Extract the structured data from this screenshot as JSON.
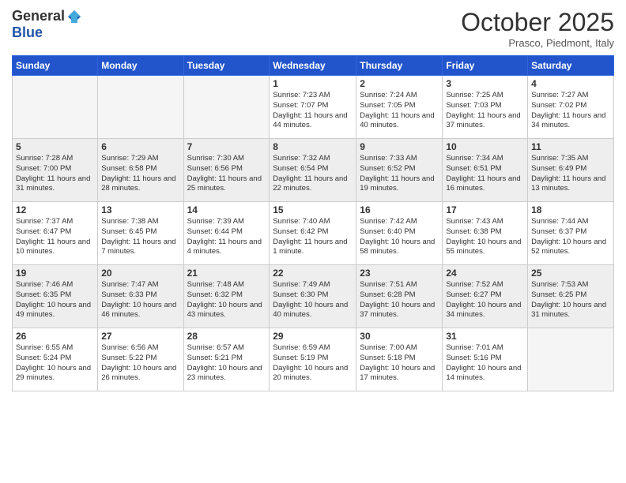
{
  "logo": {
    "general": "General",
    "blue": "Blue"
  },
  "header": {
    "month": "October 2025",
    "location": "Prasco, Piedmont, Italy"
  },
  "weekdays": [
    "Sunday",
    "Monday",
    "Tuesday",
    "Wednesday",
    "Thursday",
    "Friday",
    "Saturday"
  ],
  "weeks": [
    [
      {
        "day": "",
        "info": ""
      },
      {
        "day": "",
        "info": ""
      },
      {
        "day": "",
        "info": ""
      },
      {
        "day": "1",
        "info": "Sunrise: 7:23 AM\nSunset: 7:07 PM\nDaylight: 11 hours and 44 minutes."
      },
      {
        "day": "2",
        "info": "Sunrise: 7:24 AM\nSunset: 7:05 PM\nDaylight: 11 hours and 40 minutes."
      },
      {
        "day": "3",
        "info": "Sunrise: 7:25 AM\nSunset: 7:03 PM\nDaylight: 11 hours and 37 minutes."
      },
      {
        "day": "4",
        "info": "Sunrise: 7:27 AM\nSunset: 7:02 PM\nDaylight: 11 hours and 34 minutes."
      }
    ],
    [
      {
        "day": "5",
        "info": "Sunrise: 7:28 AM\nSunset: 7:00 PM\nDaylight: 11 hours and 31 minutes."
      },
      {
        "day": "6",
        "info": "Sunrise: 7:29 AM\nSunset: 6:58 PM\nDaylight: 11 hours and 28 minutes."
      },
      {
        "day": "7",
        "info": "Sunrise: 7:30 AM\nSunset: 6:56 PM\nDaylight: 11 hours and 25 minutes."
      },
      {
        "day": "8",
        "info": "Sunrise: 7:32 AM\nSunset: 6:54 PM\nDaylight: 11 hours and 22 minutes."
      },
      {
        "day": "9",
        "info": "Sunrise: 7:33 AM\nSunset: 6:52 PM\nDaylight: 11 hours and 19 minutes."
      },
      {
        "day": "10",
        "info": "Sunrise: 7:34 AM\nSunset: 6:51 PM\nDaylight: 11 hours and 16 minutes."
      },
      {
        "day": "11",
        "info": "Sunrise: 7:35 AM\nSunset: 6:49 PM\nDaylight: 11 hours and 13 minutes."
      }
    ],
    [
      {
        "day": "12",
        "info": "Sunrise: 7:37 AM\nSunset: 6:47 PM\nDaylight: 11 hours and 10 minutes."
      },
      {
        "day": "13",
        "info": "Sunrise: 7:38 AM\nSunset: 6:45 PM\nDaylight: 11 hours and 7 minutes."
      },
      {
        "day": "14",
        "info": "Sunrise: 7:39 AM\nSunset: 6:44 PM\nDaylight: 11 hours and 4 minutes."
      },
      {
        "day": "15",
        "info": "Sunrise: 7:40 AM\nSunset: 6:42 PM\nDaylight: 11 hours and 1 minute."
      },
      {
        "day": "16",
        "info": "Sunrise: 7:42 AM\nSunset: 6:40 PM\nDaylight: 10 hours and 58 minutes."
      },
      {
        "day": "17",
        "info": "Sunrise: 7:43 AM\nSunset: 6:38 PM\nDaylight: 10 hours and 55 minutes."
      },
      {
        "day": "18",
        "info": "Sunrise: 7:44 AM\nSunset: 6:37 PM\nDaylight: 10 hours and 52 minutes."
      }
    ],
    [
      {
        "day": "19",
        "info": "Sunrise: 7:46 AM\nSunset: 6:35 PM\nDaylight: 10 hours and 49 minutes."
      },
      {
        "day": "20",
        "info": "Sunrise: 7:47 AM\nSunset: 6:33 PM\nDaylight: 10 hours and 46 minutes."
      },
      {
        "day": "21",
        "info": "Sunrise: 7:48 AM\nSunset: 6:32 PM\nDaylight: 10 hours and 43 minutes."
      },
      {
        "day": "22",
        "info": "Sunrise: 7:49 AM\nSunset: 6:30 PM\nDaylight: 10 hours and 40 minutes."
      },
      {
        "day": "23",
        "info": "Sunrise: 7:51 AM\nSunset: 6:28 PM\nDaylight: 10 hours and 37 minutes."
      },
      {
        "day": "24",
        "info": "Sunrise: 7:52 AM\nSunset: 6:27 PM\nDaylight: 10 hours and 34 minutes."
      },
      {
        "day": "25",
        "info": "Sunrise: 7:53 AM\nSunset: 6:25 PM\nDaylight: 10 hours and 31 minutes."
      }
    ],
    [
      {
        "day": "26",
        "info": "Sunrise: 6:55 AM\nSunset: 5:24 PM\nDaylight: 10 hours and 29 minutes."
      },
      {
        "day": "27",
        "info": "Sunrise: 6:56 AM\nSunset: 5:22 PM\nDaylight: 10 hours and 26 minutes."
      },
      {
        "day": "28",
        "info": "Sunrise: 6:57 AM\nSunset: 5:21 PM\nDaylight: 10 hours and 23 minutes."
      },
      {
        "day": "29",
        "info": "Sunrise: 6:59 AM\nSunset: 5:19 PM\nDaylight: 10 hours and 20 minutes."
      },
      {
        "day": "30",
        "info": "Sunrise: 7:00 AM\nSunset: 5:18 PM\nDaylight: 10 hours and 17 minutes."
      },
      {
        "day": "31",
        "info": "Sunrise: 7:01 AM\nSunset: 5:16 PM\nDaylight: 10 hours and 14 minutes."
      },
      {
        "day": "",
        "info": ""
      }
    ]
  ]
}
